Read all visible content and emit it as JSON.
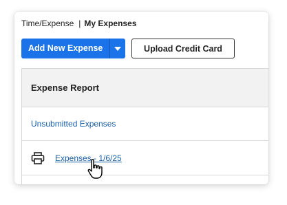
{
  "breadcrumb": {
    "parent": "Time/Expense",
    "separator": "|",
    "current": "My Expenses"
  },
  "toolbar": {
    "add_new_label": "Add New Expense",
    "dropdown_icon": "caret-down-icon",
    "upload_label": "Upload Credit Card"
  },
  "table": {
    "header": "Expense Report",
    "rows": [
      {
        "label": "Unsubmitted Expenses"
      },
      {
        "label": "Expenses - 1/6/25",
        "icon": "printer-icon"
      }
    ]
  },
  "colors": {
    "primary": "#1a73e8",
    "link": "#1a5fa8"
  }
}
